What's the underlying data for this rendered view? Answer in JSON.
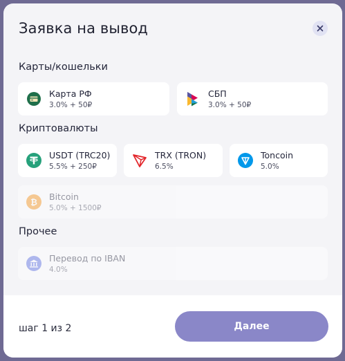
{
  "modal": {
    "title": "Заявка на вывод",
    "close_icon": "close-icon"
  },
  "sections": {
    "cards": {
      "label": "Карты/кошельки",
      "items": [
        {
          "name": "Карта РФ",
          "fee": "3.0% + 50₽",
          "icon": "bank-card-icon",
          "enabled": true
        },
        {
          "name": "СБП",
          "fee": "3.0% + 50₽",
          "icon": "sbp-icon",
          "enabled": true
        }
      ]
    },
    "crypto": {
      "label": "Криптовалюты",
      "items": [
        {
          "name": "USDT (TRC20)",
          "fee": "5.5% + 250₽",
          "icon": "tether-icon",
          "enabled": true
        },
        {
          "name": "TRX (TRON)",
          "fee": "6.5%",
          "icon": "tron-icon",
          "enabled": true
        },
        {
          "name": "Toncoin",
          "fee": "5.0%",
          "icon": "toncoin-icon",
          "enabled": true
        },
        {
          "name": "Bitcoin",
          "fee": "5.0% + 1500₽",
          "icon": "bitcoin-icon",
          "enabled": false
        }
      ]
    },
    "other": {
      "label": "Прочее",
      "items": [
        {
          "name": "Перевод по IBAN",
          "fee": "4.0%",
          "icon": "bank-building-icon",
          "enabled": false
        }
      ]
    }
  },
  "footer": {
    "step_text": "шаг 1 из 2",
    "next_label": "Далее"
  },
  "colors": {
    "backdrop": "#6f6a93",
    "modal_bg": "#f4f4f7",
    "accent_button": "#8a87c8",
    "usdt": "#26a17b",
    "tron": "#e3262b",
    "toncoin": "#0098ea",
    "bitcoin": "#f7931a",
    "iban": "#5b6ee1"
  }
}
